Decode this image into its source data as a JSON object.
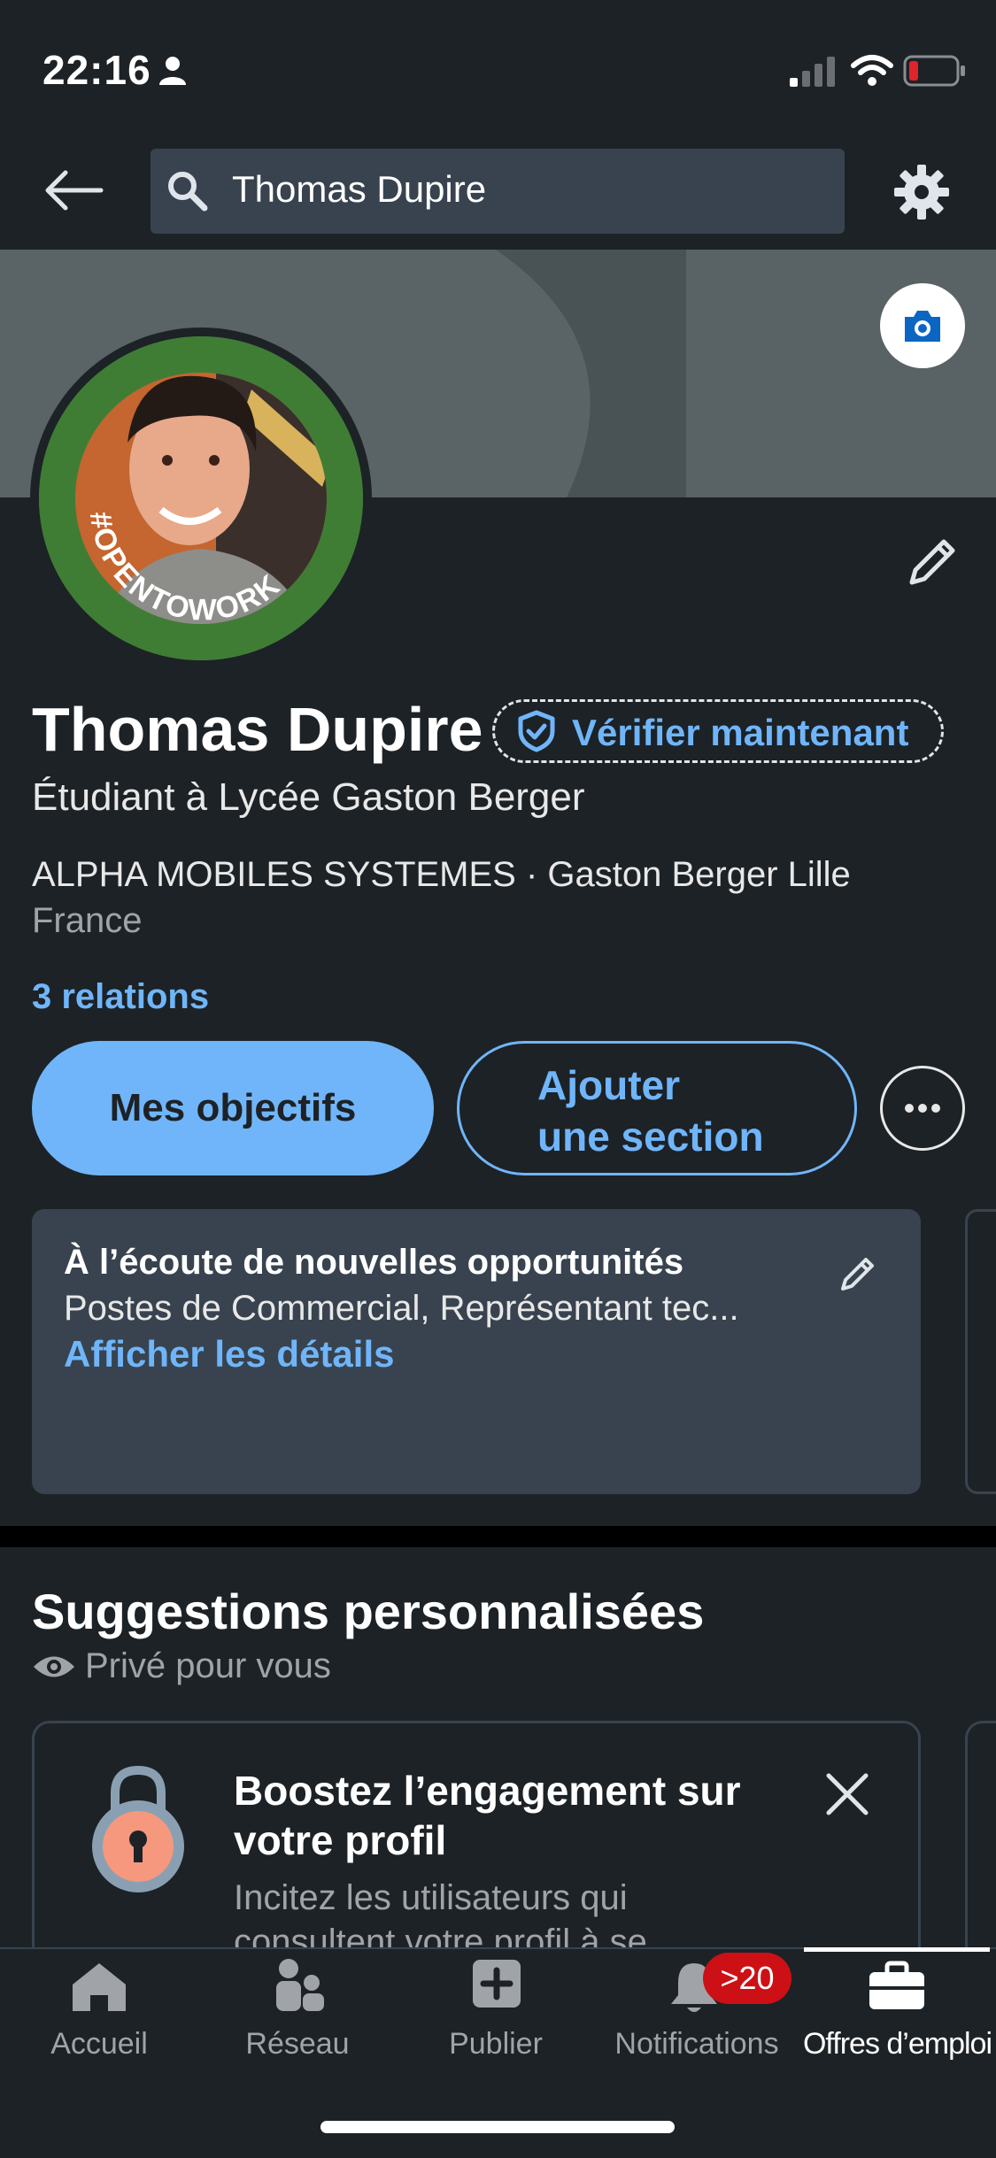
{
  "status_bar": {
    "time": "22:16"
  },
  "header": {
    "search_value": "Thomas Dupire"
  },
  "profile": {
    "name": "Thomas Dupire",
    "verify_label": "Vérifier maintenant",
    "headline": "Étudiant à Lycée Gaston Berger",
    "company_line": "ALPHA MOBILES SYSTEMES · Gaston Berger Lille",
    "location": "France",
    "relations": "3 relations",
    "frame_text": "#OPENTOWORK"
  },
  "actions": {
    "primary_label": "Mes objectifs",
    "secondary_label_line1": "Ajouter",
    "secondary_label_line2": "une section"
  },
  "open_to_work": {
    "title": "À l’écoute de nouvelles opportunités",
    "description": "Postes de Commercial, Représentant tec...",
    "link": "Afficher les détails"
  },
  "suggestions": {
    "title": "Suggestions personnalisées",
    "privacy": "Privé pour vous",
    "card": {
      "title_line1": "Boostez l’engagement sur",
      "title_line2": "votre profil",
      "desc_line1": "Incitez les utilisateurs qui",
      "desc_line2": "consultent votre profil à se"
    }
  },
  "bottom_nav": {
    "items": [
      {
        "label": "Accueil",
        "icon": "home-icon"
      },
      {
        "label": "Réseau",
        "icon": "network-icon"
      },
      {
        "label": "Publier",
        "icon": "post-icon"
      },
      {
        "label": "Notifications",
        "icon": "bell-icon"
      },
      {
        "label": "Offres d’emploi",
        "icon": "briefcase-icon"
      }
    ],
    "notification_badge": ">20",
    "active_index": 4
  },
  "colors": {
    "background": "#1d2226",
    "accent": "#70b5f9",
    "card": "#38434f",
    "badge": "#cc1016",
    "frame_green": "#3f7d35"
  }
}
